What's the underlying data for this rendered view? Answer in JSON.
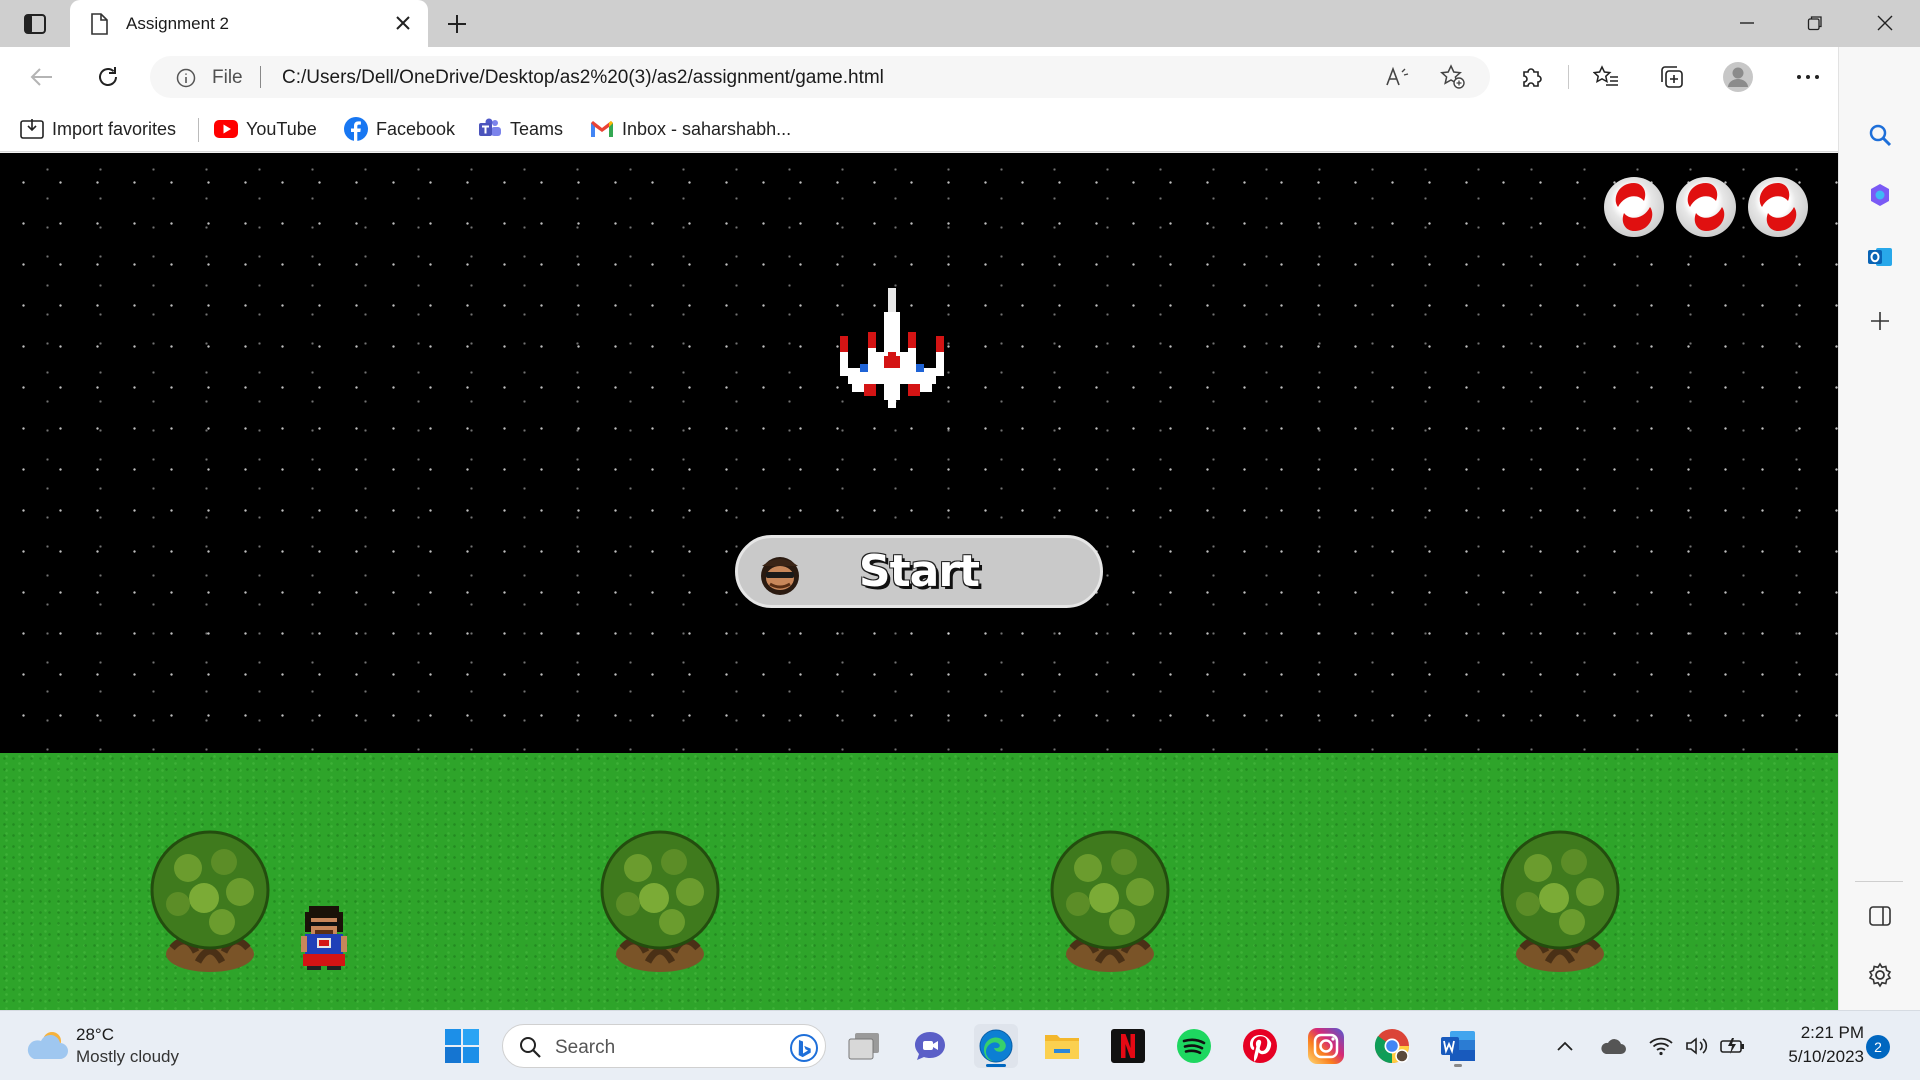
{
  "browser": {
    "tab_title": "Assignment 2",
    "address_prefix": "File",
    "url": "C:/Users/Dell/OneDrive/Desktop/as2%20(3)/as2/assignment/game.html"
  },
  "bookmarks": [
    {
      "label": "Import favorites",
      "icon": "import-icon"
    },
    {
      "label": "YouTube",
      "icon": "youtube-icon"
    },
    {
      "label": "Facebook",
      "icon": "facebook-icon"
    },
    {
      "label": "Teams",
      "icon": "teams-icon"
    },
    {
      "label": "Inbox - saharshabh...",
      "icon": "gmail-icon"
    }
  ],
  "game": {
    "start_label": "Start",
    "lives": 3,
    "colors": {
      "space": "#000000",
      "grass": "#2ea42a",
      "button": "#c9c9c9"
    }
  },
  "taskbar": {
    "weather_temp": "28°C",
    "weather_condition": "Mostly cloudy",
    "search_placeholder": "Search",
    "time": "2:21 PM",
    "date": "5/10/2023",
    "notification_count": "2"
  }
}
